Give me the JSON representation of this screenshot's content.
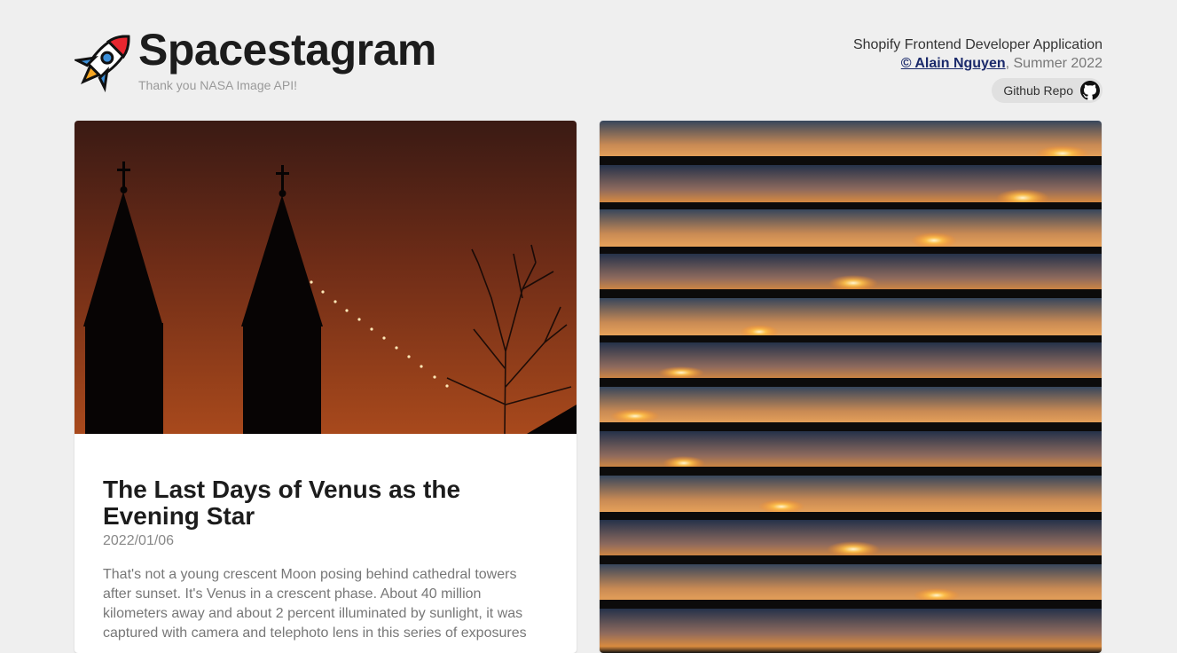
{
  "header": {
    "title": "Spacestagram",
    "subtitle": "Thank you NASA Image API!",
    "logo_icon": "rocket-icon"
  },
  "credits": {
    "line1": "Shopify Frontend Developer Application",
    "author": "© Alain Nguyen",
    "season": ", Summer 2022",
    "github_label": "Github Repo",
    "github_icon": "github-icon"
  },
  "posts": [
    {
      "title": "The Last Days of Venus as the Evening Star",
      "date": "2022/01/06",
      "description": "That's not a young crescent Moon posing behind cathedral towers after sunset. It's Venus in a crescent phase. About 40 million kilometers away and about 2 percent illuminated by sunlight, it was captured with camera and telephoto lens in this series of exposures"
    }
  ],
  "colors": {
    "background": "#efefef",
    "card": "#ffffff",
    "link": "#1b2a6b"
  }
}
